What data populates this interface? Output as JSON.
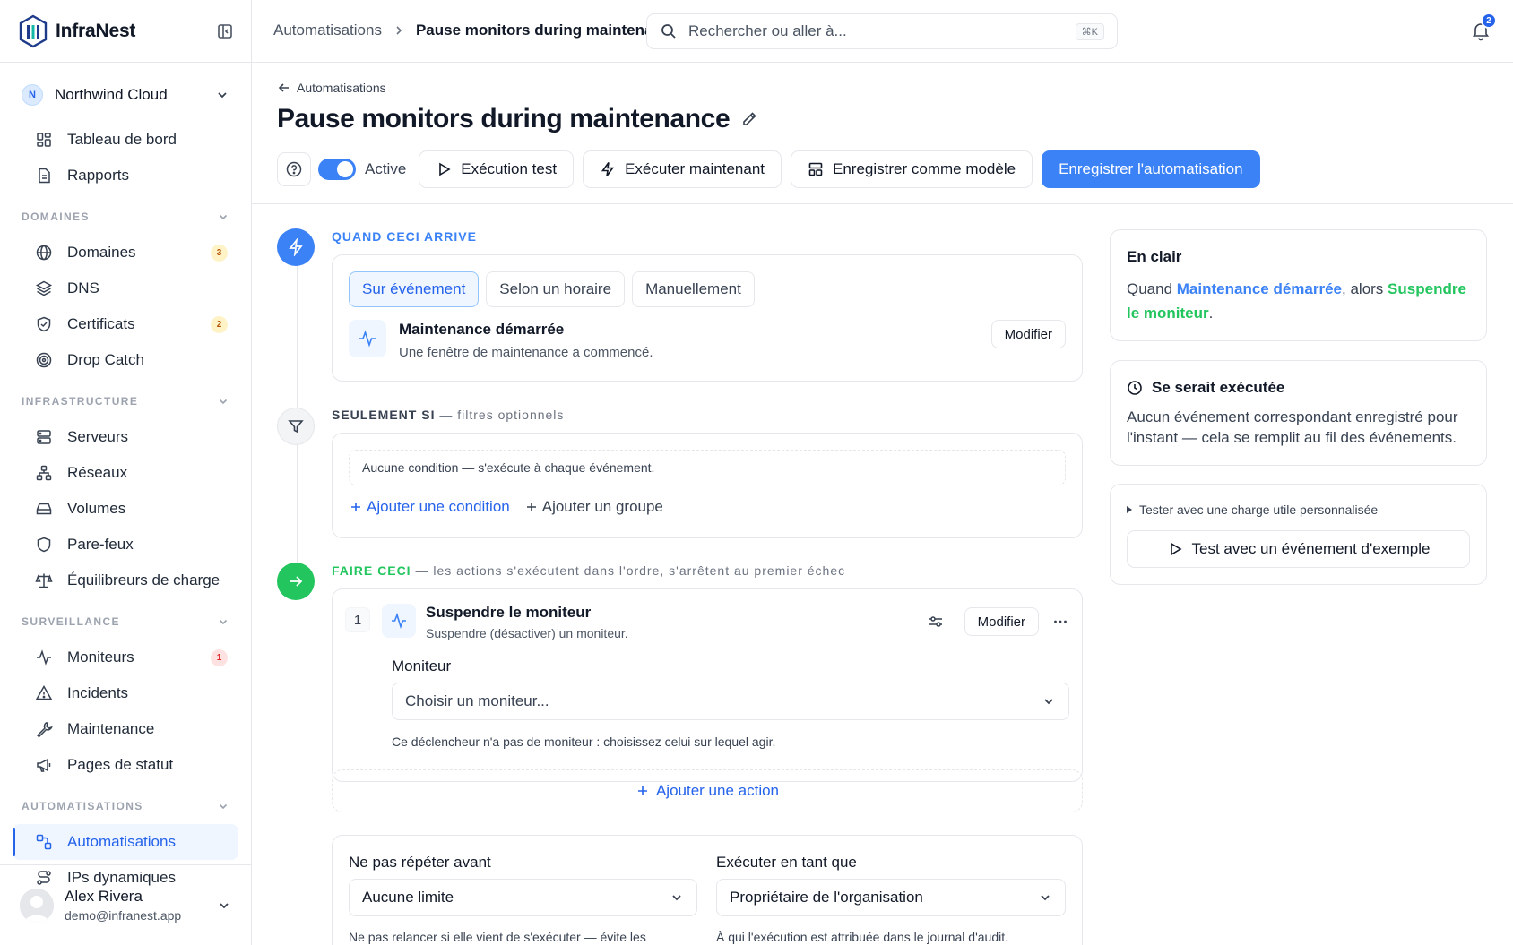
{
  "brand": {
    "name": "InfraNest"
  },
  "org": {
    "initial": "N",
    "name": "Northwind Cloud"
  },
  "nav": {
    "top": [
      {
        "label": "Tableau de bord"
      },
      {
        "label": "Rapports"
      }
    ],
    "domaines": {
      "title": "DOMAINES",
      "items": [
        {
          "label": "Domaines",
          "badge": "3"
        },
        {
          "label": "DNS"
        },
        {
          "label": "Certificats",
          "badge": "2"
        },
        {
          "label": "Drop Catch"
        }
      ]
    },
    "infrastructure": {
      "title": "INFRASTRUCTURE",
      "items": [
        {
          "label": "Serveurs"
        },
        {
          "label": "Réseaux"
        },
        {
          "label": "Volumes"
        },
        {
          "label": "Pare-feux"
        },
        {
          "label": "Équilibreurs de charge"
        }
      ]
    },
    "surveillance": {
      "title": "SURVEILLANCE",
      "items": [
        {
          "label": "Moniteurs",
          "badge": "1"
        },
        {
          "label": "Incidents"
        },
        {
          "label": "Maintenance"
        },
        {
          "label": "Pages de statut"
        }
      ]
    },
    "automatisations": {
      "title": "AUTOMATISATIONS",
      "items": [
        {
          "label": "Automatisations"
        },
        {
          "label": "IPs dynamiques"
        }
      ]
    }
  },
  "user": {
    "name": "Alex Rivera",
    "email": "demo@infranest.app"
  },
  "topbar": {
    "crumb1": "Automatisations",
    "crumb2": "Pause monitors during maintenance",
    "search_placeholder": "Rechercher ou aller à...",
    "shortcut": "⌘K",
    "notif_count": "2"
  },
  "header": {
    "back": "Automatisations",
    "title": "Pause monitors during maintenance",
    "active_label": "Active",
    "btn_test": "Exécution test",
    "btn_run": "Exécuter maintenant",
    "btn_template": "Enregistrer comme modèle",
    "btn_save": "Enregistrer l'automatisation"
  },
  "when": {
    "label": "QUAND CECI ARRIVE",
    "tabs": [
      "Sur événement",
      "Selon un horaire",
      "Manuellement"
    ],
    "trigger_title": "Maintenance démarrée",
    "trigger_desc": "Une fenêtre de maintenance a commencé.",
    "edit": "Modifier"
  },
  "only_if": {
    "label": "SEULEMENT SI",
    "sublabel": " — filtres optionnels",
    "empty": "Aucune condition — s'exécute à chaque événement.",
    "add_condition": "Ajouter une condition",
    "add_group": "Ajouter un groupe"
  },
  "do": {
    "label": "FAIRE CECI",
    "sublabel": " — les actions s'exécutent dans l'ordre, s'arrêtent au premier échec",
    "action_num": "1",
    "action_title": "Suspendre le moniteur",
    "action_desc": "Suspendre (désactiver) un moniteur.",
    "edit": "Modifier",
    "field_label": "Moniteur",
    "field_value": "Choisir un moniteur...",
    "field_hint": "Ce déclencheur n'a pas de moniteur : choisissez celui sur lequel agir.",
    "add_action": "Ajouter une action"
  },
  "settings": {
    "repeat_label": "Ne pas répéter avant",
    "repeat_value": "Aucune limite",
    "repeat_hint": "Ne pas relancer si elle vient de s'exécuter — évite les",
    "runas_label": "Exécuter en tant que",
    "runas_value": "Propriétaire de l'organisation",
    "runas_hint": "À qui l'exécution est attribuée dans le journal d'audit."
  },
  "plain": {
    "title": "En clair",
    "w1": "Quand ",
    "w2": "Maintenance démarrée",
    "w3": ", alors ",
    "w4": "Suspendre le moniteur",
    "w5": "."
  },
  "would_run": {
    "title": "Se serait exécutée",
    "body": "Aucun événement correspondant enregistré pour l'instant — cela se remplit au fil des événements."
  },
  "test": {
    "summary": "Tester avec une charge utile personnalisée",
    "button": "Test avec un événement d'exemple"
  },
  "colors": {
    "accent": "#3b82f6",
    "success": "#22c55e",
    "warning_badge": "#fef3c7",
    "danger_badge": "#fee2e2"
  }
}
